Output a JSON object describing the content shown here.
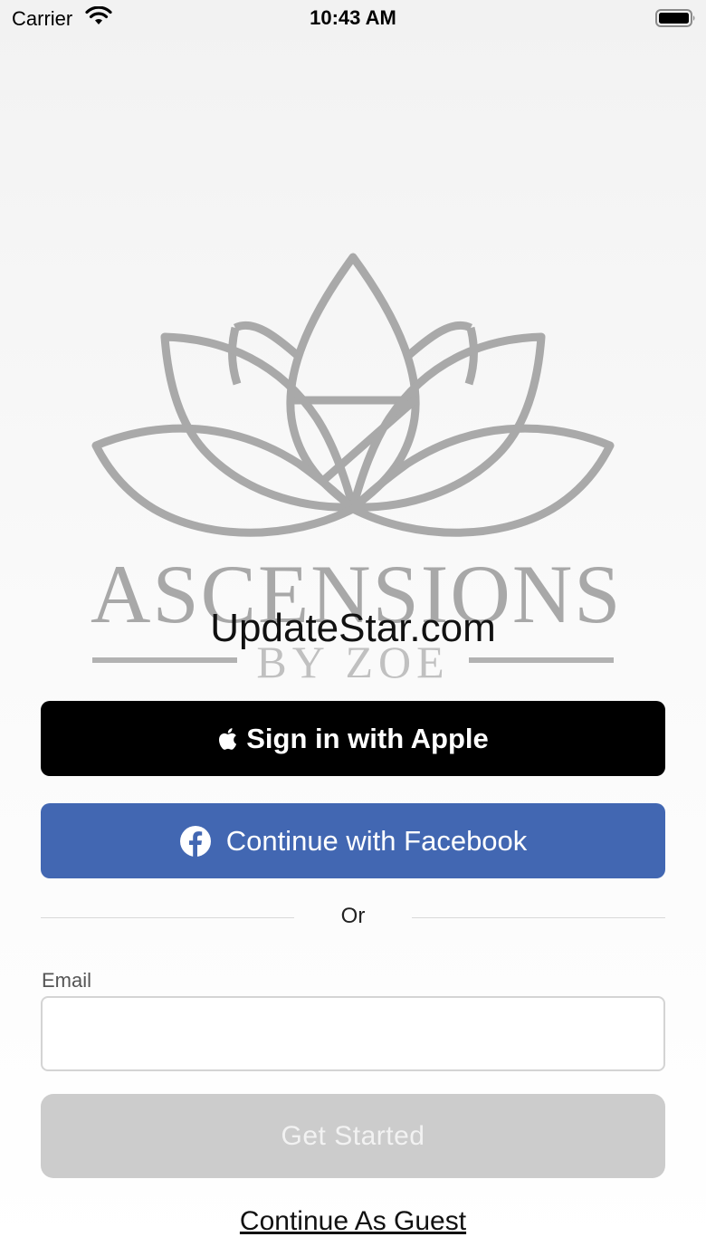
{
  "status_bar": {
    "carrier": "Carrier",
    "time": "10:43 AM",
    "wifi_icon": "wifi-icon",
    "battery_icon": "battery-icon"
  },
  "logo": {
    "brand_name": "ASCENSIONS",
    "brand_sub": "BY ZOE",
    "icon": "lotus-logo-icon"
  },
  "watermark": "UpdateStar.com",
  "auth": {
    "apple_label": "Sign in with Apple",
    "apple_icon": "apple-icon",
    "facebook_label": "Continue with Facebook",
    "facebook_icon": "facebook-icon",
    "facebook_color": "#4267b2",
    "or_label": "Or",
    "email_label": "Email",
    "email_value": "",
    "email_placeholder": "",
    "get_started_label": "Get Started",
    "get_started_color": "#cccccc",
    "guest_label": "Continue As Guest"
  }
}
